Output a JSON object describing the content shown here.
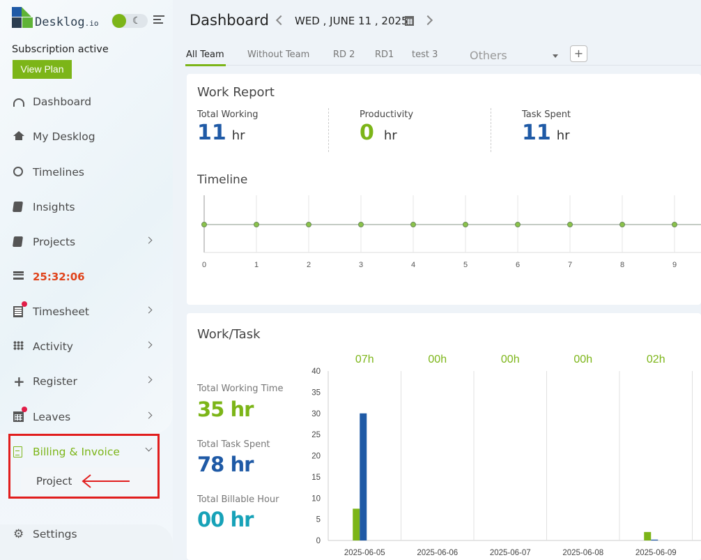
{
  "sidebar": {
    "logo_text": "Desklog",
    "logo_suffix": ".io",
    "subscription_status": "Subscription active",
    "view_plan_label": "View Plan",
    "items": [
      {
        "label": "Dashboard",
        "icon": "dashboard-icon"
      },
      {
        "label": "My Desklog",
        "icon": "home-icon"
      },
      {
        "label": "Timelines",
        "icon": "clock-icon"
      },
      {
        "label": "Insights",
        "icon": "book-icon"
      },
      {
        "label": "Projects",
        "icon": "book-icon"
      },
      {
        "label": "25:32:06",
        "icon": "timer-icon"
      },
      {
        "label": "Timesheet",
        "icon": "timesheet-icon"
      },
      {
        "label": "Activity",
        "icon": "grid-icon"
      },
      {
        "label": "Register",
        "icon": "plus-icon"
      },
      {
        "label": "Leaves",
        "icon": "calendar-icon"
      },
      {
        "label": "Billing & Invoice",
        "icon": "document-icon"
      },
      {
        "label": "Settings",
        "icon": "gear-icon"
      }
    ],
    "billing_sub_item": "Project",
    "timer_color": "#e0431b",
    "accent": "#7cb518"
  },
  "header": {
    "title": "Dashboard",
    "date": "WED , JUNE 11 , 2025"
  },
  "tabs": [
    "All Team",
    "Without Team",
    "RD 2",
    "RD1",
    "test 3"
  ],
  "tabs_others": "Others",
  "tabs_add": "+",
  "work_report": {
    "title": "Work Report",
    "total_working_label": "Total Working",
    "total_working_value": "11",
    "productivity_label": "Productivity",
    "productivity_value": "0",
    "task_spent_label": "Task Spent",
    "task_spent_value": "11",
    "unit": "hr"
  },
  "timeline": {
    "title": "Timeline",
    "ticks": [
      "0",
      "1",
      "2",
      "3",
      "4",
      "5",
      "6",
      "7",
      "8",
      "9"
    ]
  },
  "work_task": {
    "title": "Work/Task",
    "total_working_time_label": "Total Working Time",
    "total_working_time_value": "35 hr",
    "total_task_spent_label": "Total Task Spent",
    "total_task_spent_value": "78 hr",
    "total_billable_label": "Total Billable Hour",
    "total_billable_value": "00 hr"
  },
  "chart_data": {
    "type": "bar",
    "categories": [
      "2025-06-05",
      "2025-06-06",
      "2025-06-07",
      "2025-06-08",
      "2025-06-09"
    ],
    "top_labels": [
      "07h",
      "00h",
      "00h",
      "00h",
      "02h"
    ],
    "series": [
      {
        "values": [
          7.5,
          0,
          0,
          0,
          2
        ],
        "color": "#7cb518"
      },
      {
        "values": [
          30,
          0,
          0,
          0,
          0.2
        ],
        "color": "#1f5aa6"
      }
    ],
    "ylim": [
      0,
      40
    ],
    "yticks": [
      "0",
      "5",
      "10",
      "15",
      "20",
      "25",
      "30",
      "35",
      "40"
    ]
  }
}
